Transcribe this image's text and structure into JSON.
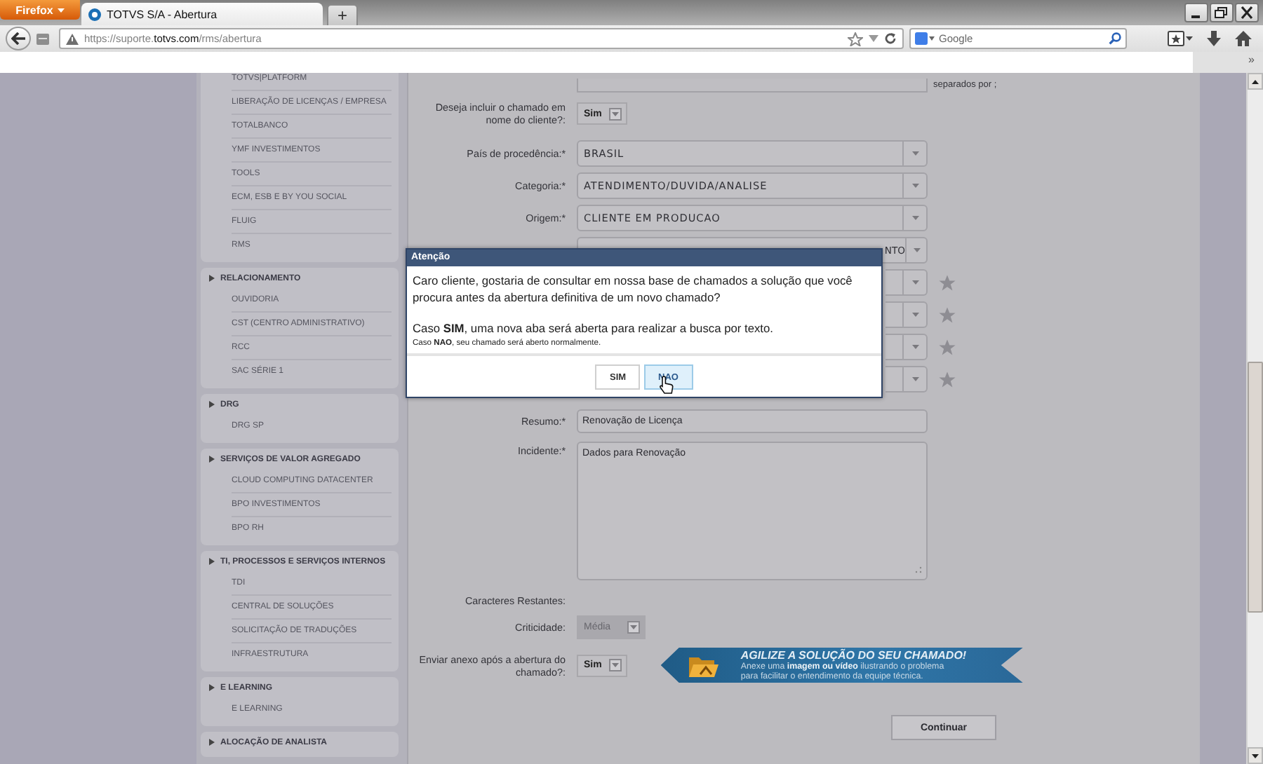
{
  "browser": {
    "menu_button": "Firefox",
    "tab_title": "TOTVS S/A - Abertura",
    "new_tab": "+",
    "url": "https://suporte.**totvs.com**/rms/abertura",
    "search_placeholder": "Google",
    "overflow": "»"
  },
  "sidebar": {
    "groups": [
      {
        "items": [
          "TOTVS|PLATFORM",
          "LIBERAÇÃO DE LICENÇAS / EMPRESA",
          "TOTALBANCO",
          "YMF INVESTIMENTOS",
          "TOOLS",
          "ECM, ESB E BY YOU SOCIAL",
          "FLUIG",
          "RMS"
        ]
      },
      {
        "title": "RELACIONAMENTO",
        "items": [
          "OUVIDORIA",
          "CST (CENTRO ADMINISTRATIVO)",
          "RCC",
          "SAC SÉRIE 1"
        ]
      },
      {
        "title": "DRG",
        "items": [
          "DRG SP"
        ]
      },
      {
        "title": "SERVIÇOS DE VALOR AGREGADO",
        "items": [
          "CLOUD COMPUTING DATACENTER",
          "BPO INVESTIMENTOS",
          "BPO RH"
        ]
      },
      {
        "title": "TI, PROCESSOS E SERVIÇOS INTERNOS",
        "items": [
          "TDI",
          "CENTRAL DE SOLUÇÕES",
          "SOLICITAÇÃO DE TRADUÇÕES",
          "INFRAESTRUTURA"
        ]
      },
      {
        "title": "E LEARNING",
        "items": [
          "E LEARNING"
        ]
      },
      {
        "title": "ALOCAÇÃO DE ANALISTA"
      }
    ]
  },
  "form": {
    "rows": [
      {
        "kind": "cut-field",
        "note": "separados por ;"
      },
      {
        "kind": "small-select",
        "label": "Deseja incluir o chamado em nome do cliente?:",
        "value": "Sim",
        "disabled": false
      },
      {
        "kind": "select",
        "label": "País de procedência:*",
        "value": "BRASIL",
        "starred": false
      },
      {
        "kind": "select",
        "label": "Categoria:*",
        "value": "ATENDIMENTO/DUVIDA/ANALISE",
        "starred": false
      },
      {
        "kind": "select",
        "label": "Origem:*",
        "value": "CLIENTE EM PRODUCAO",
        "starred": false
      },
      {
        "kind": "select-tail",
        "value": "NTO",
        "starred": false
      },
      {
        "kind": "select",
        "starred": true
      },
      {
        "kind": "select",
        "starred": true
      },
      {
        "kind": "select",
        "starred": true
      },
      {
        "kind": "select",
        "starred": true
      },
      {
        "kind": "input",
        "label": "Resumo:*",
        "value": "Renovação de Licença"
      },
      {
        "kind": "textarea",
        "label": "Incidente:*",
        "value": "Dados para Renovação"
      },
      {
        "kind": "text",
        "label": "Caracteres Restantes:"
      },
      {
        "kind": "small-select",
        "label": "Criticidade:",
        "value": "Média",
        "disabled": true
      },
      {
        "kind": "small-select",
        "label": "Enviar anexo após a abertura do chamado?:",
        "value": "Sim",
        "disabled": false,
        "banner": {
          "title": "AGILIZE A SOLUÇÃO DO SEU CHAMADO!",
          "lines": [
            "Anexe uma **imagem ou vídeo** ilustrando o problema",
            "para facilitar o entendimento da equipe técnica."
          ]
        }
      }
    ],
    "submit": "Continuar"
  },
  "dialog": {
    "title": "Atenção",
    "paragraphs": [
      "Caro cliente, gostaria de consultar em nossa base de chamados a solução que você procura antes da abertura definitiva de um novo chamado?",
      "Caso **SIM**, uma nova aba será aberta para realizar a busca por texto."
    ],
    "note": "Caso **NAO**, seu chamado será aberto normalmente.",
    "buttons": [
      {
        "label": "SIM",
        "selected": false
      },
      {
        "label": "NAO",
        "selected": true
      }
    ]
  }
}
